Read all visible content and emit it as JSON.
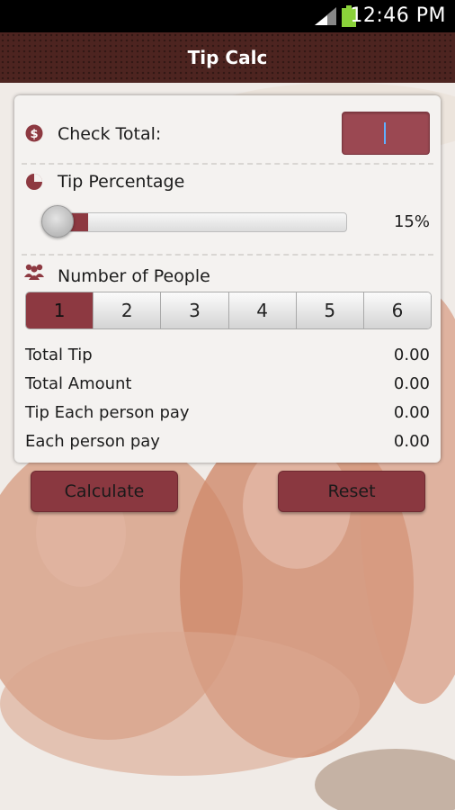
{
  "status_bar": {
    "time": "12:46 PM"
  },
  "app": {
    "title": "Tip Calc"
  },
  "check_total": {
    "label": "Check Total:",
    "value": ""
  },
  "tip_percentage": {
    "label": "Tip Percentage",
    "value": 15,
    "value_label": "15%"
  },
  "people": {
    "label": "Number of People",
    "options": [
      "1",
      "2",
      "3",
      "4",
      "5",
      "6"
    ],
    "selected": "1"
  },
  "results": [
    {
      "label": "Total Tip",
      "value": "0.00"
    },
    {
      "label": "Total Amount",
      "value": "0.00"
    },
    {
      "label": "Tip Each person pay",
      "value": "0.00"
    },
    {
      "label": "Each person pay",
      "value": "0.00"
    }
  ],
  "buttons": {
    "calculate": "Calculate",
    "reset": "Reset"
  },
  "colors": {
    "accent": "#8d3941",
    "titlebar": "#4d2420"
  }
}
